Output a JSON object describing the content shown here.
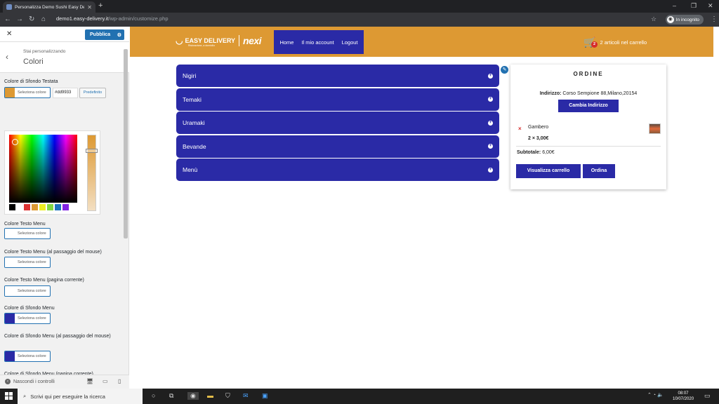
{
  "browser": {
    "tab_title": "Personalizza Demo Sushi Easy De",
    "url_host": "demo1.easy-delivery.it",
    "url_path": "/wp-admin/customize.php",
    "incognito_label": "In incognito"
  },
  "customizer": {
    "publish_label": "Pubblica",
    "breadcrumb": "Stai personalizzando",
    "section_title": "Colori",
    "header_bg_label": "Colore di Sfondo Testata",
    "select_color": "Seleziona colore",
    "hex_value": "#dd9933",
    "default_label": "Predefinito",
    "palette": [
      "#000000",
      "#dd3333",
      "#dd9933",
      "#eeee22",
      "#81d742",
      "#1e73be",
      "#8224e3"
    ],
    "settings": [
      {
        "label": "Colore Testo Menu",
        "color": "#ffffff"
      },
      {
        "label": "Colore Testo Menu (al passaggio del mouse)",
        "color": "#ffffff"
      },
      {
        "label": "Colore Testo Menu (pagina corrente)",
        "color": "#ffffff"
      },
      {
        "label": "Colore di Sfondo Menu",
        "color": "#2a2aa6"
      },
      {
        "label": "Colore di Sfondo Menu (al passaggio del mouse)",
        "color": "#2a2aa6"
      },
      {
        "label": "Colore di Sfondo Menu (pagina corrente)",
        "color": "#2a2aa6"
      }
    ],
    "hide_controls": "Nascondi i controlli"
  },
  "site": {
    "logo_text": "EASY DELIVERY",
    "logo_tagline": "Ristorazione, a domicilio",
    "logo_partner": "nexi",
    "menu": [
      "Home",
      "Il mio account",
      "Logout"
    ],
    "cart_count": "2",
    "cart_label": "2 articoli nel carrello",
    "categories": [
      "Nigiri",
      "Temaki",
      "Uramaki",
      "Bevande",
      "Menù"
    ],
    "order": {
      "title": "ORDINE",
      "address_label": "Indirizzo:",
      "address_value": "Corso Sempione 88,Milano,20154",
      "change_address": "Cambia Indirizzo",
      "item_name": "Gambero",
      "item_qty": "2 × 3,00€",
      "subtotal_label": "Subtotale:",
      "subtotal_value": "6,00€",
      "view_cart": "Visualizza carrello",
      "checkout": "Ordina"
    },
    "colors": {
      "header": "#dd9933",
      "menu_bg": "#2a2aa6"
    }
  },
  "taskbar": {
    "search_placeholder": "Scrivi qui per eseguire la ricerca",
    "time": "08:07",
    "date": "10/07/2020"
  }
}
